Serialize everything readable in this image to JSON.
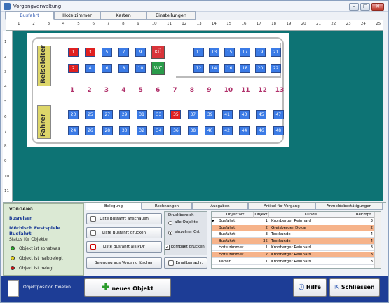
{
  "window": {
    "title": "Vorgangverwaltung",
    "min": "–",
    "max": "□",
    "close": "✕"
  },
  "tabs": [
    "Busfahrt",
    "Hotelzimmer",
    "Karten",
    "Einstellungen"
  ],
  "ruler_h": [
    "1",
    "2",
    "3",
    "4",
    "5",
    "6",
    "7",
    "8",
    "9",
    "10",
    "11",
    "12",
    "13",
    "14",
    "15",
    "16",
    "17",
    "18",
    "19",
    "20",
    "21",
    "22",
    "23",
    "24",
    "25"
  ],
  "ruler_v": [
    "1",
    "2",
    "3",
    "4",
    "5",
    "6",
    "7",
    "8",
    "9",
    "10",
    "11"
  ],
  "bus": {
    "reiseleiter": "Reiseleiter",
    "fahrer": "Fahrer",
    "ku": "KÜ",
    "wc": "WC",
    "rows": [
      "1",
      "2",
      "3",
      "4",
      "5",
      "6",
      "7",
      "8",
      "9",
      "10",
      "11",
      "12",
      "13"
    ],
    "seats_top1": [
      {
        "n": "1",
        "s": "red"
      },
      {
        "n": "3",
        "s": "red"
      },
      {
        "n": "5",
        "s": "blue"
      },
      {
        "n": "7",
        "s": "blue"
      },
      {
        "n": "9",
        "s": "blue"
      }
    ],
    "seats_top2": [
      {
        "n": "2",
        "s": "red"
      },
      {
        "n": "4",
        "s": "blue"
      },
      {
        "n": "6",
        "s": "blue"
      },
      {
        "n": "8",
        "s": "blue"
      },
      {
        "n": "10",
        "s": "blue"
      }
    ],
    "seats_top1r": [
      {
        "n": "11",
        "s": "blue"
      },
      {
        "n": "13",
        "s": "blue"
      },
      {
        "n": "15",
        "s": "blue"
      },
      {
        "n": "17",
        "s": "blue"
      },
      {
        "n": "19",
        "s": "blue"
      },
      {
        "n": "21",
        "s": "blue"
      }
    ],
    "seats_top2r": [
      {
        "n": "12",
        "s": "blue"
      },
      {
        "n": "14",
        "s": "blue"
      },
      {
        "n": "16",
        "s": "blue"
      },
      {
        "n": "18",
        "s": "blue"
      },
      {
        "n": "20",
        "s": "blue"
      },
      {
        "n": "22",
        "s": "blue"
      }
    ],
    "seats_bot1": [
      {
        "n": "23",
        "s": "blue"
      },
      {
        "n": "25",
        "s": "blue"
      },
      {
        "n": "27",
        "s": "blue"
      },
      {
        "n": "29",
        "s": "blue"
      },
      {
        "n": "31",
        "s": "blue"
      },
      {
        "n": "33",
        "s": "blue"
      },
      {
        "n": "35",
        "s": "red"
      },
      {
        "n": "37",
        "s": "blue"
      },
      {
        "n": "39",
        "s": "blue"
      },
      {
        "n": "41",
        "s": "blue"
      },
      {
        "n": "43",
        "s": "blue"
      },
      {
        "n": "45",
        "s": "blue"
      },
      {
        "n": "47",
        "s": "blue"
      }
    ],
    "seats_bot2": [
      {
        "n": "24",
        "s": "blue"
      },
      {
        "n": "26",
        "s": "blue"
      },
      {
        "n": "28",
        "s": "blue"
      },
      {
        "n": "30",
        "s": "blue"
      },
      {
        "n": "32",
        "s": "blue"
      },
      {
        "n": "34",
        "s": "blue"
      },
      {
        "n": "36",
        "s": "blue"
      },
      {
        "n": "38",
        "s": "blue"
      },
      {
        "n": "40",
        "s": "blue"
      },
      {
        "n": "42",
        "s": "blue"
      },
      {
        "n": "44",
        "s": "blue"
      },
      {
        "n": "46",
        "s": "blue"
      },
      {
        "n": "48",
        "s": "blue"
      }
    ]
  },
  "left": {
    "vorgang": "VORGANG",
    "type": "Busreisen",
    "name": "Mörbisch Festspiele Busfahrt",
    "status_title": "Status für Objekte",
    "s1": "Objekt ist sonstwas",
    "s2": "Objekt ist halbbelegt",
    "s3": "Objekt ist belegt"
  },
  "bottom_tabs": [
    "Belegung",
    "Rechnungen",
    "Ausgaben",
    "Artikel für Vorgang",
    "Anmeldebestätigungen"
  ],
  "buttons": {
    "liste_ansehen": "Liste Busfahrt anschauen",
    "liste_drucken": "Liste Busfahrt drucken",
    "liste_pdf": "Liste Busfahrt als PDF",
    "belegung_loeschen": "Belegung aus Vorgang löschen"
  },
  "druck": {
    "title": "Druckbereich",
    "opt1": "alle Objekte",
    "opt2": "einzelner Ort",
    "kompakt": "kompakt drucken",
    "email": "Emailbenachr."
  },
  "table": {
    "headers": [
      "Objektart",
      "Objekt",
      "Kunde",
      "ReEmpf"
    ],
    "rows": [
      {
        "art": "Busfahrt",
        "obj": "1",
        "kunde": "Kronberger Reinhard",
        "re": "3",
        "hl": false,
        "cur": true
      },
      {
        "art": "Busfahrt",
        "obj": "2",
        "kunde": "Greisberger Dokar",
        "re": "2",
        "hl": true,
        "cur": false
      },
      {
        "art": "Busfahrt",
        "obj": "3",
        "kunde": "Testkunde",
        "re": "4",
        "hl": false,
        "cur": false
      },
      {
        "art": "Busfahrt",
        "obj": "35",
        "kunde": "Testkunde",
        "re": "4",
        "hl": true,
        "cur": false
      },
      {
        "art": "Hotelzimmer",
        "obj": "1",
        "kunde": "Kronberger Reinhard",
        "re": "3",
        "hl": false,
        "cur": false
      },
      {
        "art": "Hotelzimmer",
        "obj": "2",
        "kunde": "Kronberger Reinhard",
        "re": "3",
        "hl": true,
        "cur": false
      },
      {
        "art": "Karten",
        "obj": "1",
        "kunde": "Kronberger Reinhard",
        "re": "3",
        "hl": false,
        "cur": false
      }
    ]
  },
  "footer": {
    "fixieren": "Objektposition fixieren",
    "neu": "neues Objekt",
    "hilfe": "Hilfe",
    "schliessen": "Schliessen"
  }
}
